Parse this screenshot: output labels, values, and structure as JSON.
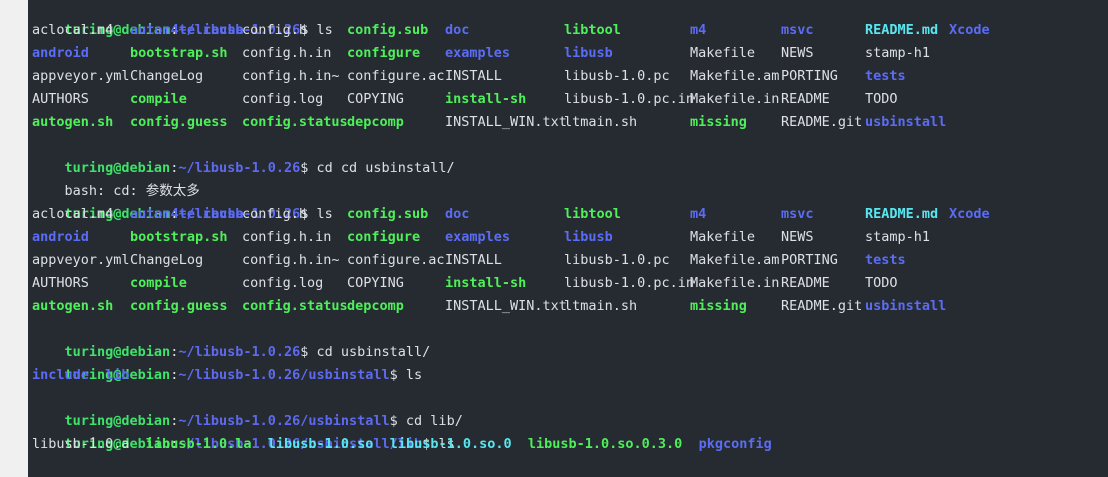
{
  "terminal": {
    "user_host": "turing@debian",
    "prompt_sep": ":",
    "prompt_sym": "$",
    "paths": {
      "root": "~/libusb-1.0.26",
      "usbinstall": "~/libusb-1.0.26/usbinstall",
      "lib": "~/libusb-1.0.26/usbinstall/lib"
    },
    "commands": {
      "ls": " ls",
      "cd_cd": " cd cd usbinstall/",
      "cd_usbinstall": " cd usbinstall/",
      "cd_lib": " cd lib/"
    },
    "error_text": "bash: cd: 参数太多",
    "listing_rows": [
      [
        {
          "name": "aclocal.m4",
          "kind": "reg"
        },
        {
          "name": "autom4te.cache",
          "kind": "dir"
        },
        {
          "name": "config.h",
          "kind": "reg"
        },
        {
          "name": "config.sub",
          "kind": "exe"
        },
        {
          "name": "doc",
          "kind": "dir"
        },
        {
          "name": "libtool",
          "kind": "exe"
        },
        {
          "name": "m4",
          "kind": "dir"
        },
        {
          "name": "msvc",
          "kind": "dir"
        },
        {
          "name": "README.md",
          "kind": "lnk"
        },
        {
          "name": "Xcode",
          "kind": "dir"
        }
      ],
      [
        {
          "name": "android",
          "kind": "dir"
        },
        {
          "name": "bootstrap.sh",
          "kind": "exe"
        },
        {
          "name": "config.h.in",
          "kind": "reg"
        },
        {
          "name": "configure",
          "kind": "exe"
        },
        {
          "name": "examples",
          "kind": "dir"
        },
        {
          "name": "libusb",
          "kind": "dir"
        },
        {
          "name": "Makefile",
          "kind": "reg"
        },
        {
          "name": "NEWS",
          "kind": "reg"
        },
        {
          "name": "stamp-h1",
          "kind": "reg"
        },
        {
          "name": "",
          "kind": "reg"
        }
      ],
      [
        {
          "name": "appveyor.yml",
          "kind": "reg"
        },
        {
          "name": "ChangeLog",
          "kind": "reg"
        },
        {
          "name": "config.h.in~",
          "kind": "reg"
        },
        {
          "name": "configure.ac",
          "kind": "reg"
        },
        {
          "name": "INSTALL",
          "kind": "reg"
        },
        {
          "name": "libusb-1.0.pc",
          "kind": "reg"
        },
        {
          "name": "Makefile.am",
          "kind": "reg"
        },
        {
          "name": "PORTING",
          "kind": "reg"
        },
        {
          "name": "tests",
          "kind": "dir"
        },
        {
          "name": "",
          "kind": "reg"
        }
      ],
      [
        {
          "name": "AUTHORS",
          "kind": "reg"
        },
        {
          "name": "compile",
          "kind": "exe"
        },
        {
          "name": "config.log",
          "kind": "reg"
        },
        {
          "name": "COPYING",
          "kind": "reg"
        },
        {
          "name": "install-sh",
          "kind": "exe"
        },
        {
          "name": "libusb-1.0.pc.in",
          "kind": "reg"
        },
        {
          "name": "Makefile.in",
          "kind": "reg"
        },
        {
          "name": "README",
          "kind": "reg"
        },
        {
          "name": "TODO",
          "kind": "reg"
        },
        {
          "name": "",
          "kind": "reg"
        }
      ],
      [
        {
          "name": "autogen.sh",
          "kind": "exe"
        },
        {
          "name": "config.guess",
          "kind": "exe"
        },
        {
          "name": "config.status",
          "kind": "exe"
        },
        {
          "name": "depcomp",
          "kind": "exe"
        },
        {
          "name": "INSTALL_WIN.txt",
          "kind": "reg"
        },
        {
          "name": "ltmain.sh",
          "kind": "reg"
        },
        {
          "name": "missing",
          "kind": "exe"
        },
        {
          "name": "README.git",
          "kind": "reg"
        },
        {
          "name": "usbinstall",
          "kind": "dir"
        },
        {
          "name": "",
          "kind": "reg"
        }
      ]
    ],
    "usbinstall_listing": [
      {
        "name": "include",
        "kind": "dir"
      },
      {
        "name": "lib",
        "kind": "dir"
      }
    ],
    "lib_listing": [
      {
        "name": "libusb-1.0.a",
        "kind": "reg"
      },
      {
        "name": "libusb-1.0.la",
        "kind": "exe"
      },
      {
        "name": "libusb-1.0.so",
        "kind": "lnk"
      },
      {
        "name": "libusb-1.0.so.0",
        "kind": "lnk"
      },
      {
        "name": "libusb-1.0.so.0.3.0",
        "kind": "exe"
      },
      {
        "name": "pkgconfig",
        "kind": "dir"
      }
    ]
  }
}
